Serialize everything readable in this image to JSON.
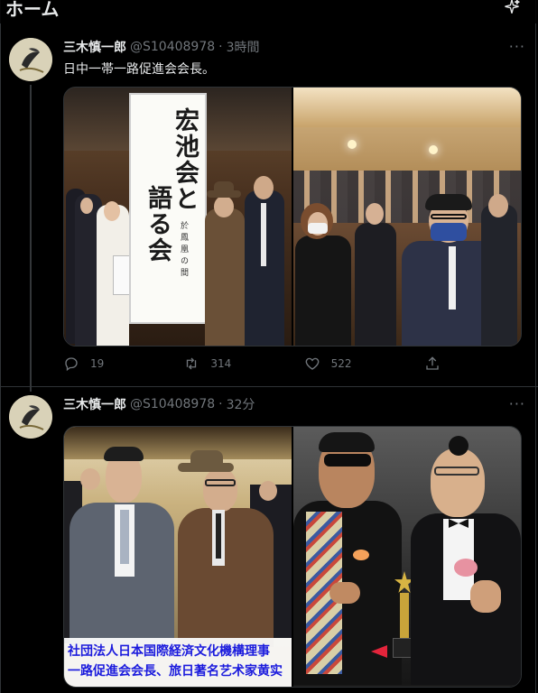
{
  "header": {
    "title": "ホーム",
    "sparkle_icon": "sparkle-icon"
  },
  "tweets": [
    {
      "author": "三木慎一郎",
      "handle": "@S10408978",
      "separator": "·",
      "time": "3時間",
      "text": "日中一帯一路促進会会長。",
      "banner": {
        "line1": "宏池会と",
        "line2": "語る会",
        "sub": "於鳳凰の間"
      },
      "actions": {
        "replies": "19",
        "retweets": "314",
        "likes": "522"
      }
    },
    {
      "author": "三木慎一郎",
      "handle": "@S10408978",
      "separator": "·",
      "time": "32分",
      "caption": {
        "line1": "社団法人日本国際経済文化機構理事",
        "line2": "一路促進会会長、旅日著名艺术家黄实"
      }
    }
  ],
  "colors": {
    "background": "#000000",
    "text": "#e7e9ea",
    "secondary": "#71767b",
    "border": "#2f3336",
    "caption_text": "#1b1bdd"
  }
}
